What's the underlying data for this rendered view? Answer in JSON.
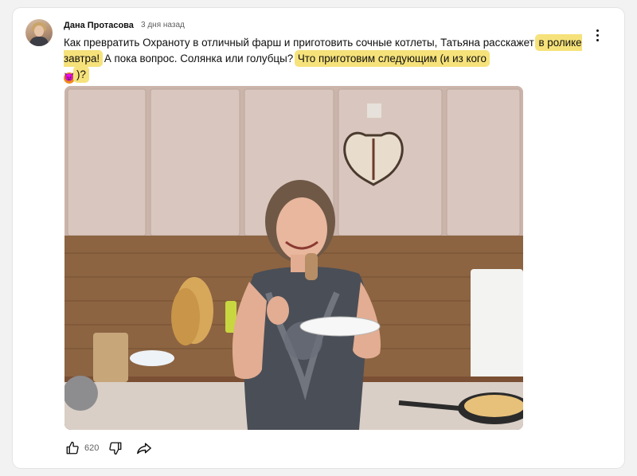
{
  "post": {
    "author": "Дана Протасова",
    "time": "3 дня назад",
    "text_start": "Как превратить Охраноту в отличный фарш и приготовить сочные котлеты, Татьяна расскажет ",
    "text_hl1": "в ролике завтра!",
    "text_mid": " А пока вопрос. Солянка или голубцы? ",
    "text_hl2": "Что приготовим следующим (и из кого",
    "emoji": "😈",
    "text_hl3": ")?",
    "likes": "620"
  },
  "colors": {
    "highlight": "#f6e27a",
    "text": "#0f0f0f",
    "muted": "#606060"
  },
  "icons": {
    "menu": "more-vert-icon",
    "like": "thumbs-up-icon",
    "dislike": "thumbs-down-icon",
    "share": "share-icon"
  }
}
